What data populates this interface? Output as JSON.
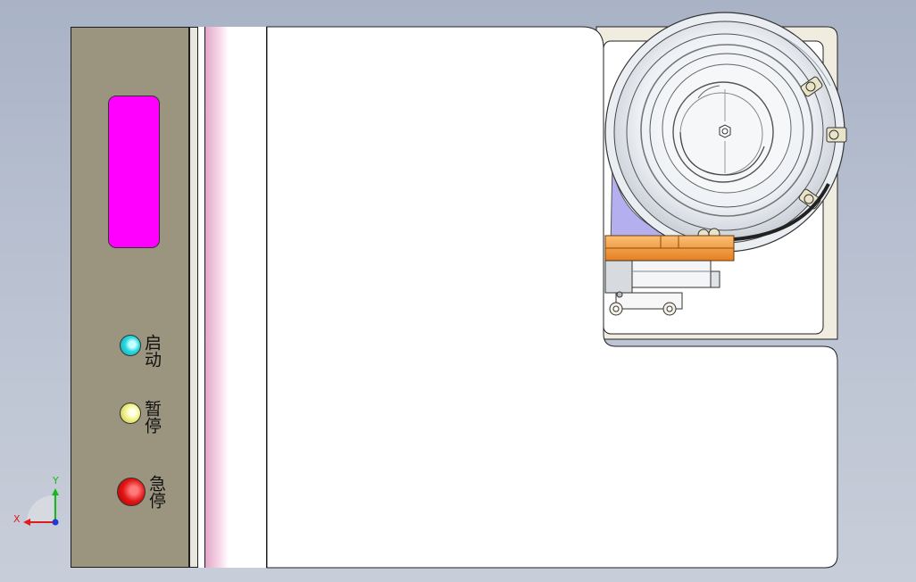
{
  "panel": {
    "buttons": [
      {
        "id": "start",
        "label": "启动",
        "color": "#29d8e0"
      },
      {
        "id": "pause",
        "label": "暂停",
        "color": "#f2f28c"
      },
      {
        "id": "estop",
        "label": "急停",
        "color": "#e31515"
      }
    ],
    "display_color": "#ff00ff",
    "panel_color": "#9b9580"
  },
  "axes": {
    "x_label": "X",
    "y_label": "Y"
  },
  "colors": {
    "background": "#b9c1d1",
    "feeder_bowl": "#e4e8ee",
    "chute": "#b4b0f0",
    "rail": "#f59a3a",
    "frame": "#f1ece0"
  }
}
